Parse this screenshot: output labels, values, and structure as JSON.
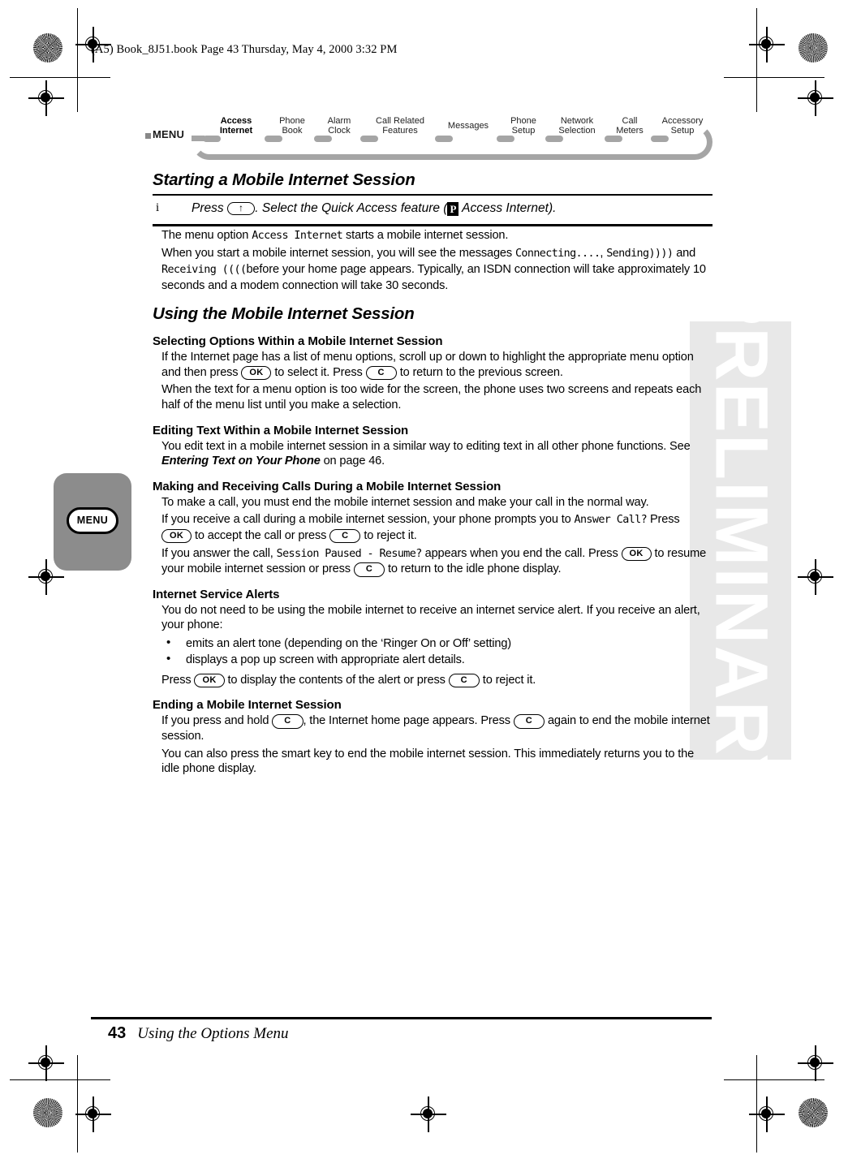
{
  "header": {
    "slug": "(A5) Book_8J51.book  Page 43  Thursday, May 4, 2000  3:32 PM"
  },
  "watermark": {
    "text": "PRELIMINARY"
  },
  "margin_tab": {
    "key_label": "MENU"
  },
  "menu_path": {
    "label": "MENU",
    "items": [
      {
        "line1": "Access",
        "line2": "Internet",
        "selected": true
      },
      {
        "line1": "Phone",
        "line2": "Book",
        "selected": false
      },
      {
        "line1": "Alarm",
        "line2": "Clock",
        "selected": false
      },
      {
        "line1": "Call Related",
        "line2": "Features",
        "selected": false
      },
      {
        "line1": "Messages",
        "line2": "",
        "selected": false
      },
      {
        "line1": "Phone",
        "line2": "Setup",
        "selected": false
      },
      {
        "line1": "Network",
        "line2": "Selection",
        "selected": false
      },
      {
        "line1": "Call",
        "line2": "Meters",
        "selected": false
      },
      {
        "line1": "Accessory",
        "line2": "Setup",
        "selected": false
      }
    ]
  },
  "sections": {
    "starting": {
      "title": "Starting a Mobile Internet Session",
      "step": {
        "number": "i",
        "pre": "Press",
        "key": "↑",
        "mid": ". Select the Quick Access feature (",
        "glyph": "P",
        "post": " Access Internet)."
      },
      "p1_a": "The menu option ",
      "p1_lcd": "Access Internet",
      "p1_b": " starts a mobile internet session.",
      "p2_a": "When you start a mobile internet session, you will see the messages ",
      "p2_lcd1": "Connecting....",
      "p2_b": ", ",
      "p2_lcd2": "Sending))))",
      "p2_c": " and ",
      "p2_lcd3": "Receiving ((((",
      "p2_d": "before your home page appears. Typically, an ISDN connection will take approximately 10 seconds and a modem connection will take 30 seconds."
    },
    "using": {
      "title": "Using the Mobile Internet Session",
      "selecting": {
        "heading": "Selecting Options Within a Mobile Internet Session",
        "p1_a": "If the Internet page has a list of menu options, scroll up or down to highlight the appropriate menu option and then press ",
        "p1_key1": "OK",
        "p1_b": " to select it. Press ",
        "p1_key2": "C",
        "p1_c": " to return to the previous screen.",
        "p2": "When the text for a menu option is too wide for the screen, the phone uses two screens and repeats each half of the menu list until you make a selection."
      },
      "editing": {
        "heading": "Editing Text Within a Mobile Internet Session",
        "p1_a": "You edit text in a mobile internet session in a similar way to editing text in all other phone functions. See ",
        "p1_ref": "Entering Text on Your Phone",
        "p1_b": " on page 46."
      },
      "calls": {
        "heading": "Making and Receiving Calls During a Mobile Internet Session",
        "p1": "To make a call, you must end the mobile internet session and make your call in the normal way.",
        "p2_a": "If you receive a call during a mobile internet session, your phone prompts you to ",
        "p2_lcd": "Answer Call?",
        "p2_b": " Press ",
        "p2_key1": "OK",
        "p2_c": " to accept the call or press ",
        "p2_key2": "C",
        "p2_d": " to reject it.",
        "p3_a": "If you answer the call, ",
        "p3_lcd": "Session Paused - Resume?",
        "p3_b": " appears when you end the call. Press ",
        "p3_key1": "OK",
        "p3_c": " to resume your mobile internet session or press ",
        "p3_key2": "C",
        "p3_d": " to return to the idle phone display."
      },
      "alerts": {
        "heading": "Internet Service Alerts",
        "p1": "You do not need to be using the mobile internet to receive an internet service alert. If you receive an alert, your phone:",
        "bullets": [
          "emits an alert tone (depending on the ‘Ringer On or Off’ setting)",
          "displays a pop up screen with appropriate alert details."
        ],
        "p2_a": "Press ",
        "p2_key1": "OK",
        "p2_b": " to display the contents of the alert or press ",
        "p2_key2": "C",
        "p2_c": " to reject it."
      },
      "ending": {
        "heading": "Ending a Mobile Internet Session",
        "p1_a": "If you press and hold ",
        "p1_key1": "C",
        "p1_b": ", the Internet home page appears. Press ",
        "p1_key2": "C",
        "p1_c": " again to end the mobile internet session.",
        "p2": "You can also press the smart key to end the mobile internet session. This immediately returns you to the idle phone display."
      }
    }
  },
  "footer": {
    "page_number": "43",
    "text": "Using the Options Menu"
  }
}
